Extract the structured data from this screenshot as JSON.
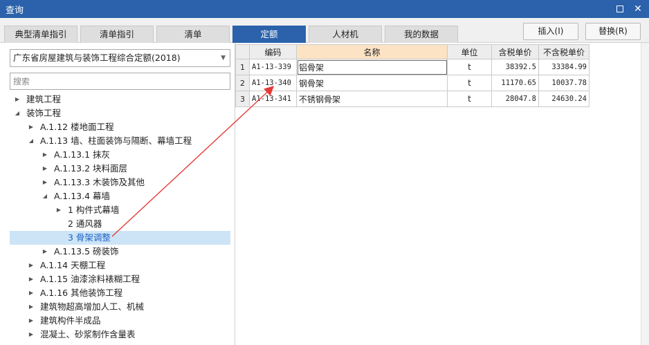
{
  "window": {
    "title": "查询",
    "maximize_icon": "maximize-icon",
    "close_label": "✕"
  },
  "tabs": [
    {
      "label": "典型清单指引",
      "active": false
    },
    {
      "label": "清单指引",
      "active": false
    },
    {
      "label": "清单",
      "active": false
    },
    {
      "label": "定额",
      "active": true
    },
    {
      "label": "人材机",
      "active": false
    },
    {
      "label": "我的数据",
      "active": false
    }
  ],
  "actions": {
    "insert_label": "插入(I)",
    "replace_label": "替换(R)"
  },
  "left": {
    "library_select": "广东省房屋建筑与装饰工程综合定额(2018)",
    "search_placeholder": "搜索",
    "tree": [
      {
        "label": "建筑工程",
        "level": 0,
        "state": "collapsed"
      },
      {
        "label": "装饰工程",
        "level": 0,
        "state": "expanded"
      },
      {
        "label": "A.1.12 楼地面工程",
        "level": 1,
        "state": "collapsed"
      },
      {
        "label": "A.1.13 墙、柱面装饰与隔断、幕墙工程",
        "level": 1,
        "state": "expanded"
      },
      {
        "label": "A.1.13.1 抹灰",
        "level": 2,
        "state": "collapsed"
      },
      {
        "label": "A.1.13.2 块料面层",
        "level": 2,
        "state": "collapsed"
      },
      {
        "label": "A.1.13.3 木装饰及其他",
        "level": 2,
        "state": "collapsed"
      },
      {
        "label": "A.1.13.4 幕墙",
        "level": 2,
        "state": "expanded"
      },
      {
        "label": "1 构件式幕墙",
        "level": 3,
        "state": "collapsed"
      },
      {
        "label": "2 通风器",
        "level": 3,
        "state": "leaf"
      },
      {
        "label": "3 骨架调整",
        "level": 3,
        "state": "leaf",
        "selected": true
      },
      {
        "label": "A.1.13.5 磅装饰",
        "level": 2,
        "state": "collapsed"
      },
      {
        "label": "A.1.14 天棚工程",
        "level": 1,
        "state": "collapsed"
      },
      {
        "label": "A.1.15 油漆涂料裱糊工程",
        "level": 1,
        "state": "collapsed"
      },
      {
        "label": "A.1.16 其他装饰工程",
        "level": 1,
        "state": "collapsed"
      },
      {
        "label": "建筑物超高增加人工、机械",
        "level": 1,
        "state": "collapsed"
      },
      {
        "label": "建筑构件半成品",
        "level": 1,
        "state": "collapsed"
      },
      {
        "label": "混凝土、砂浆制作含量表",
        "level": 1,
        "state": "collapsed"
      }
    ]
  },
  "table": {
    "columns": [
      "编码",
      "名称",
      "单位",
      "含税单价",
      "不含税单价"
    ],
    "rows": [
      {
        "num": "1",
        "code": "A1-13-339",
        "name": "铝骨架",
        "unit": "t",
        "price_tax": "38392.5",
        "price_notax": "33384.99"
      },
      {
        "num": "2",
        "code": "A1-13-340",
        "name": "钢骨架",
        "unit": "t",
        "price_tax": "11170.65",
        "price_notax": "10037.78"
      },
      {
        "num": "3",
        "code": "A1-13-341",
        "name": "不锈钢骨架",
        "unit": "t",
        "price_tax": "28047.8",
        "price_notax": "24630.24"
      }
    ]
  },
  "colors": {
    "accent": "#2b62ab",
    "annotation_arrow": "#e53935",
    "selected_row": "#cde4f7",
    "name_header": "#fbe3c4"
  }
}
